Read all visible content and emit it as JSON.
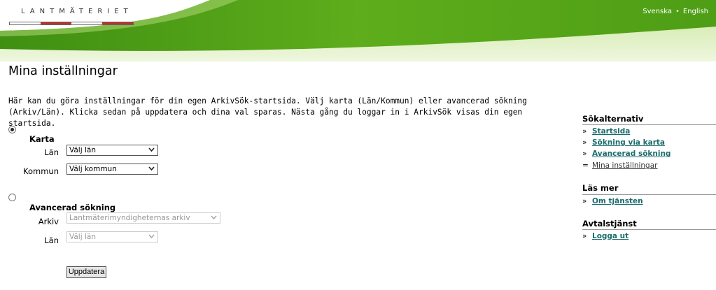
{
  "header": {
    "logo_text": "LANTMÄTERIET",
    "lang_svenska": "Svenska",
    "lang_sep": "•",
    "lang_english": "English",
    "colors": {
      "green": "#5da618",
      "logo_red": "#b8322b"
    }
  },
  "page": {
    "title": "Mina inställningar",
    "intro": "Här kan du göra inställningar för din egen ArkivSök-startsida. Välj karta (Län/Kommun) eller avancerad sökning (Arkiv/Län). Klicka sedan på uppdatera och dina val sparas. Nästa gång du loggar in i ArkivSök visas din egen startsida."
  },
  "karta": {
    "title": "Karta",
    "selected": true,
    "lan_label": "Län",
    "lan_value": "Välj län",
    "kommun_label": "Kommun",
    "kommun_value": "Välj kommun"
  },
  "avancerad": {
    "title": "Avancerad sökning",
    "selected": false,
    "arkiv_label": "Arkiv",
    "arkiv_value": "Lantmäterimyndigheternas arkiv",
    "lan_label": "Län",
    "lan_value": "Välj län"
  },
  "update_label": "Uppdatera",
  "sidebar": {
    "sokalternativ": {
      "title": "Sökalternativ",
      "items": [
        {
          "mark": "»",
          "label": "Startsida"
        },
        {
          "mark": "»",
          "label": "Sökning via karta"
        },
        {
          "mark": "»",
          "label": "Avancerad sökning"
        },
        {
          "mark": "=",
          "label": "Mina inställningar"
        }
      ]
    },
    "las_mer": {
      "title": "Läs mer",
      "items": [
        {
          "mark": "»",
          "label": "Om tjänsten"
        }
      ]
    },
    "avtalstjanst": {
      "title": "Avtalstjänst",
      "items": [
        {
          "mark": "»",
          "label": "Logga ut"
        }
      ]
    }
  }
}
